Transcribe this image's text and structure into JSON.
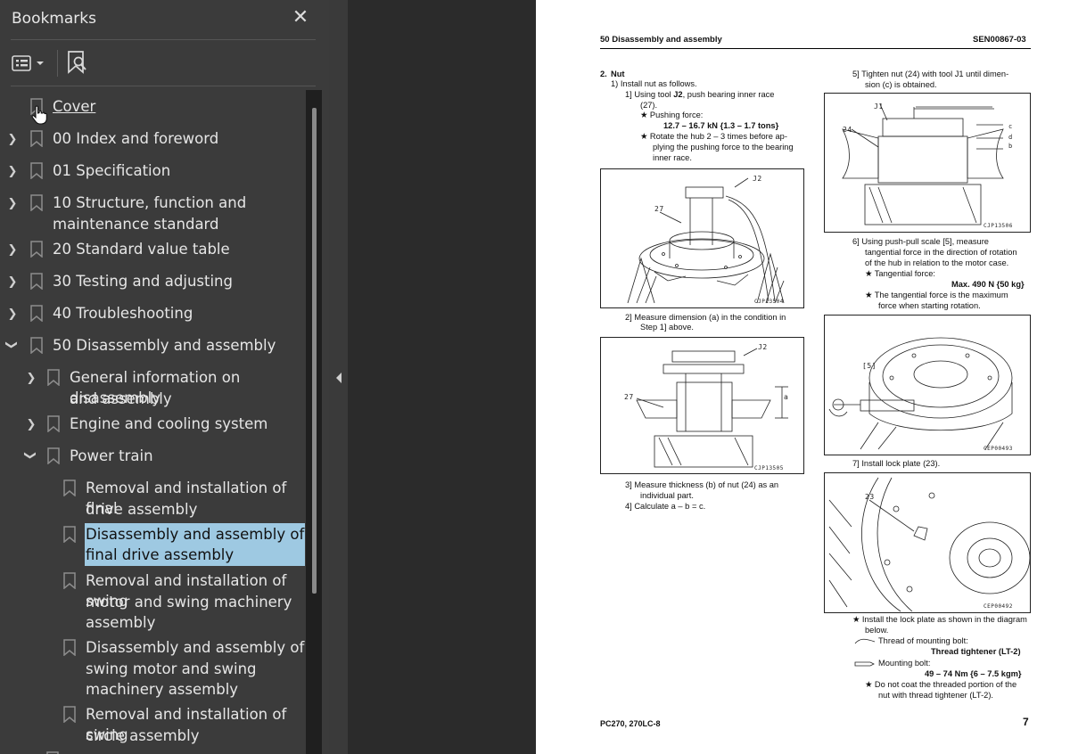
{
  "sidebar": {
    "title": "Bookmarks",
    "close_glyph": "✕",
    "options_icon": "bookmark-options-icon",
    "find_icon": "find-bookmark-icon",
    "items": [
      {
        "label": "Cover",
        "level": 0,
        "expander": "none"
      },
      {
        "label": "00 Index and foreword",
        "level": 0,
        "expander": "collapsed"
      },
      {
        "label": "01 Specification",
        "level": 0,
        "expander": "collapsed"
      },
      {
        "label_line1": "10 Structure, function and",
        "label_line2": "maintenance standard",
        "level": 0,
        "expander": "collapsed"
      },
      {
        "label": "20 Standard value table",
        "level": 0,
        "expander": "collapsed"
      },
      {
        "label": "30 Testing and adjusting",
        "level": 0,
        "expander": "collapsed"
      },
      {
        "label": "40 Troubleshooting",
        "level": 0,
        "expander": "collapsed"
      },
      {
        "label": "50 Disassembly and assembly",
        "level": 0,
        "expander": "expanded"
      },
      {
        "label_line1": "General information on disassembly",
        "label_line2": "and assembly",
        "level": 1,
        "expander": "collapsed"
      },
      {
        "label": "Engine and cooling system",
        "level": 1,
        "expander": "collapsed"
      },
      {
        "label": "Power train",
        "level": 1,
        "expander": "expanded"
      },
      {
        "label_line1": "Removal and installation of final",
        "label_line2": "drive assembly",
        "level": 2,
        "expander": "none"
      },
      {
        "label_line1": "Disassembly and assembly of",
        "label_line2": "final drive assembly",
        "level": 2,
        "expander": "none",
        "selected": true
      },
      {
        "label_line1": "Removal and installation of swing",
        "label_line2": "motor and swing machinery",
        "label_line3": "assembly",
        "level": 2,
        "expander": "none"
      },
      {
        "label_line1": "Disassembly and assembly of",
        "label_line2": "swing motor and swing",
        "label_line3": "machinery assembly",
        "level": 2,
        "expander": "none"
      },
      {
        "label_line1": "Removal and installation of swing",
        "label_line2": "circle assembly",
        "level": 2,
        "expander": "none"
      }
    ]
  },
  "document": {
    "header_left": "50 Disassembly and assembly",
    "header_right": "SEN00867-03",
    "footer_left": "PC270, 270LC-8",
    "footer_right": "7",
    "left_col": {
      "step": "2.",
      "step_title": "Nut",
      "l1": "1)  Install nut as follows.",
      "l2a": "1]  Using tool ",
      "l2b": "J2",
      "l2c": ", push bearing inner race",
      "l3": "(27).",
      "l4": "★  Pushing force:",
      "l5": "12.7 – 16.7 kN {1.3 – 1.7 tons}",
      "l6": "★  Rotate the hub 2 – 3 times before ap-",
      "l7": "plying the pushing force to the bearing",
      "l8": "inner race.",
      "fig1_code": "CJP13504",
      "fig1_l1": "J2",
      "fig1_l2": "27",
      "m1": "2]  Measure dimension (a) in the condition in",
      "m2": "Step 1] above.",
      "fig2_code": "CJP13505",
      "fig2_l1": "J2",
      "fig2_l2": "27",
      "fig2_l3": "a",
      "n1": "3]  Measure thickness (b) of nut (24) as an",
      "n2": "individual part.",
      "n3": "4]  Calculate a – b = c."
    },
    "right_col": {
      "r1": "5]  Tighten nut (24) with tool J1 until dimen-",
      "r2": "sion (c) is obtained.",
      "fig3_code": "CJP13506",
      "fig3_l1": "J1",
      "fig3_l2": "24",
      "fig3_c": "c",
      "fig3_d": "d",
      "fig3_b": "b",
      "s1": "6]  Using  push-pull  scale  [5],  measure",
      "s2": "tangential force in the direction of rotation",
      "s3": "of the hub in relation to the motor case.",
      "s4": "★  Tangential force:",
      "s5": "Max. 490 N {50 kg}",
      "s6": "★  The tangential force is the maximum",
      "s7": "force when starting rotation.",
      "fig4_code": "CEP00493",
      "fig4_l1": "[5]",
      "p1": "7]  Install lock plate (23).",
      "fig5_code": "CEP00492",
      "fig5_l1": "23",
      "q1": "★  Install the lock plate as shown in the diagram",
      "q2": "below.",
      "q3": "Thread of mounting bolt:",
      "q4": "Thread tightener (LT-2)",
      "q5": "Mounting bolt:",
      "q6": "49 – 74 Nm {6 – 7.5 kgm}",
      "q7": "★  Do not coat the threaded portion of the",
      "q8": "nut with thread tightener (LT-2)."
    }
  },
  "colors": {
    "selection": "#9ec9e2",
    "sidebar_bg": "#3b3b3b",
    "viewer_bg": "#2b2b2b"
  }
}
